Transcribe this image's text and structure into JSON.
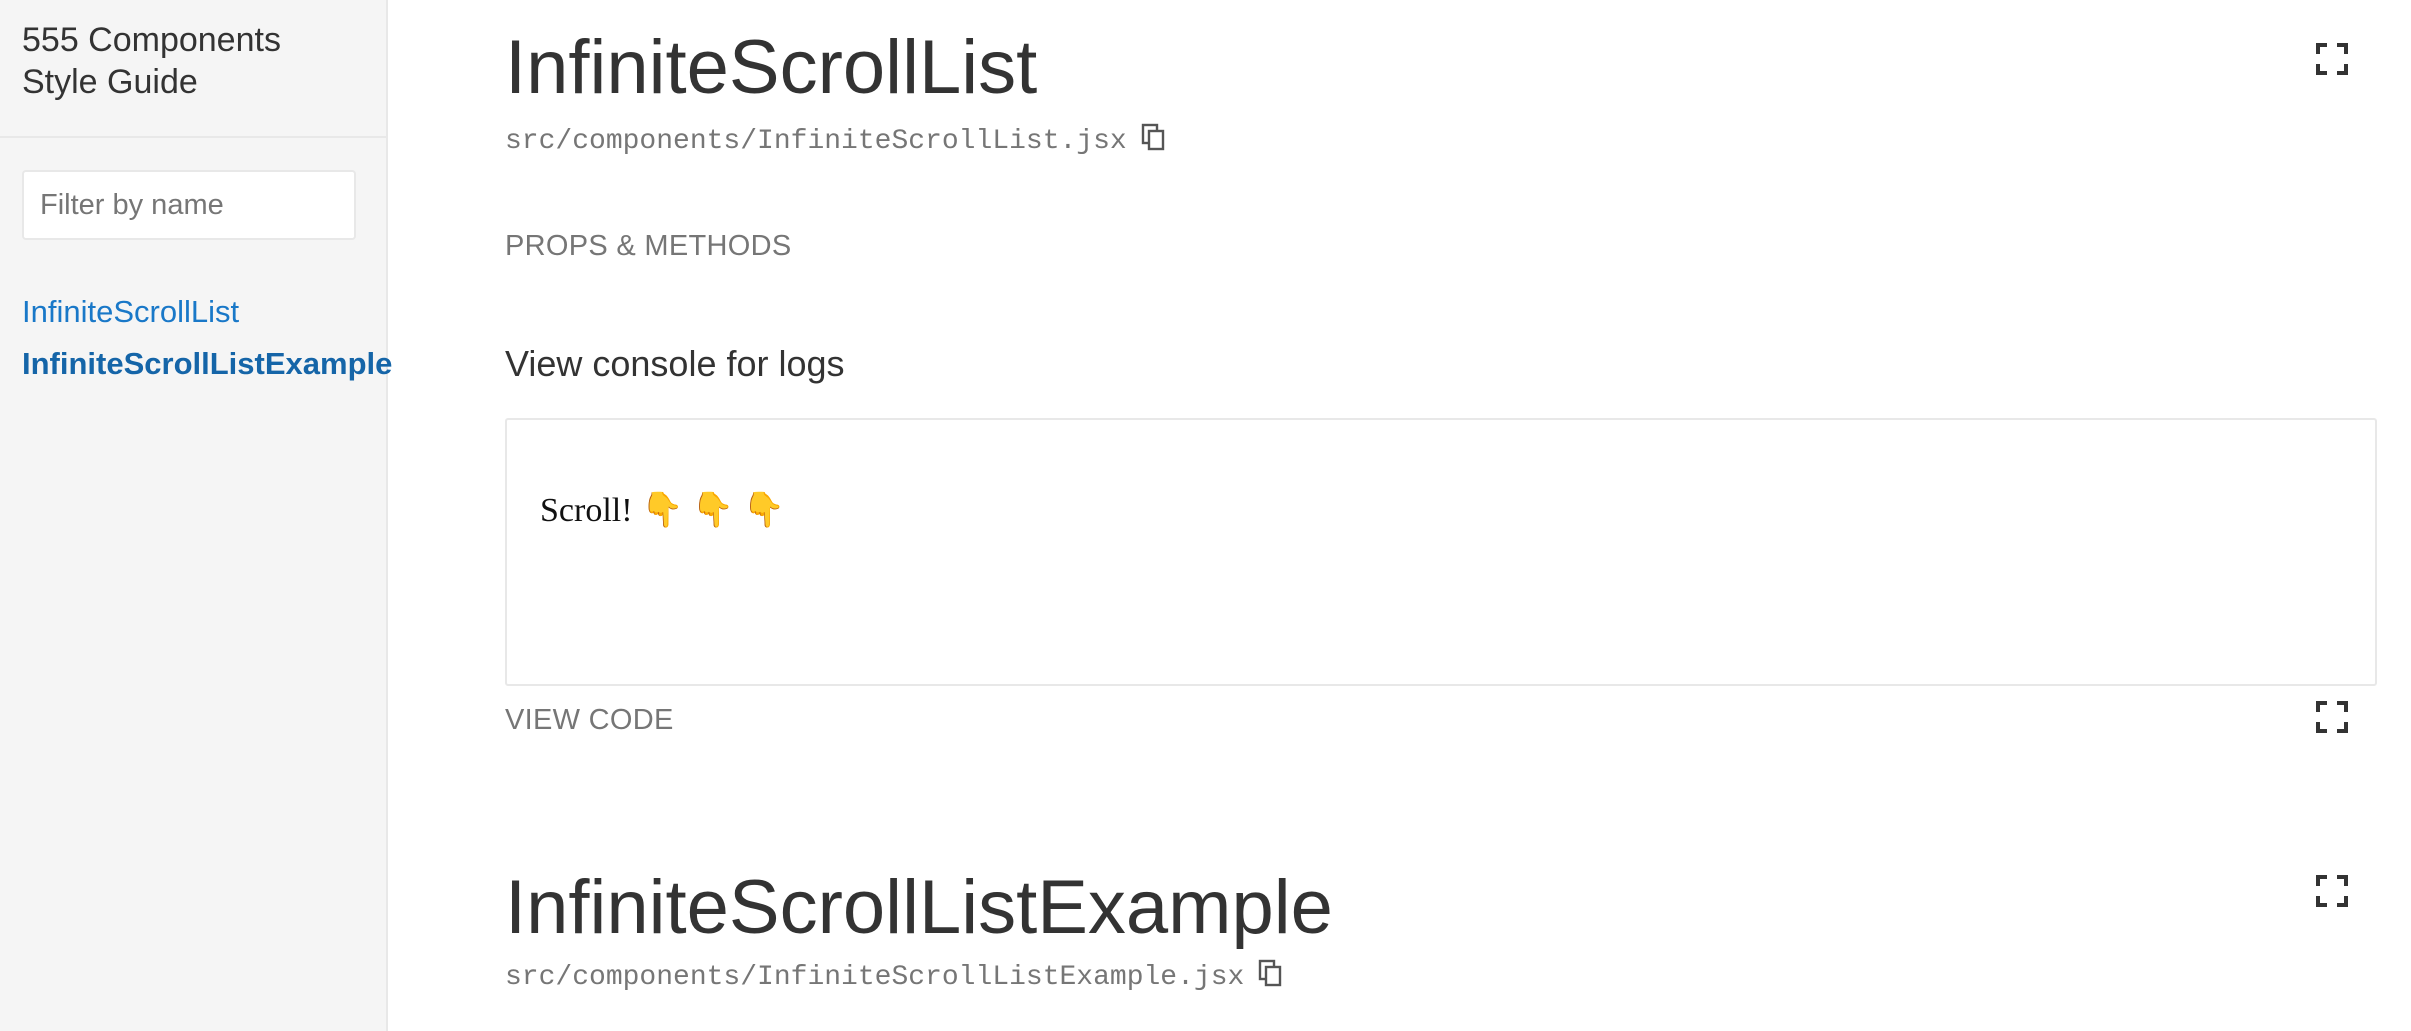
{
  "sidebar": {
    "title": "555 Components\nStyle Guide",
    "filter_placeholder": "Filter by name",
    "items": [
      {
        "label": "InfiniteScrollList",
        "active": false
      },
      {
        "label": "InfiniteScrollListExample",
        "active": true
      }
    ]
  },
  "components": [
    {
      "name": "InfiniteScrollList",
      "path": "src/components/InfiniteScrollList.jsx",
      "props_label": "PROPS & METHODS",
      "example": {
        "description": "View console for logs",
        "preview_text": "Scroll! 👇 👇 👇",
        "view_code_label": "VIEW CODE"
      }
    },
    {
      "name": "InfiniteScrollListExample",
      "path": "src/components/InfiniteScrollListExample.jsx"
    }
  ],
  "icons": {
    "copy": "copy-icon",
    "isolate": "fullscreen-icon"
  },
  "colors": {
    "link": "#1978c8",
    "muted": "#767676",
    "sidebar_bg": "#f5f5f5",
    "border": "#e8e8e8"
  }
}
